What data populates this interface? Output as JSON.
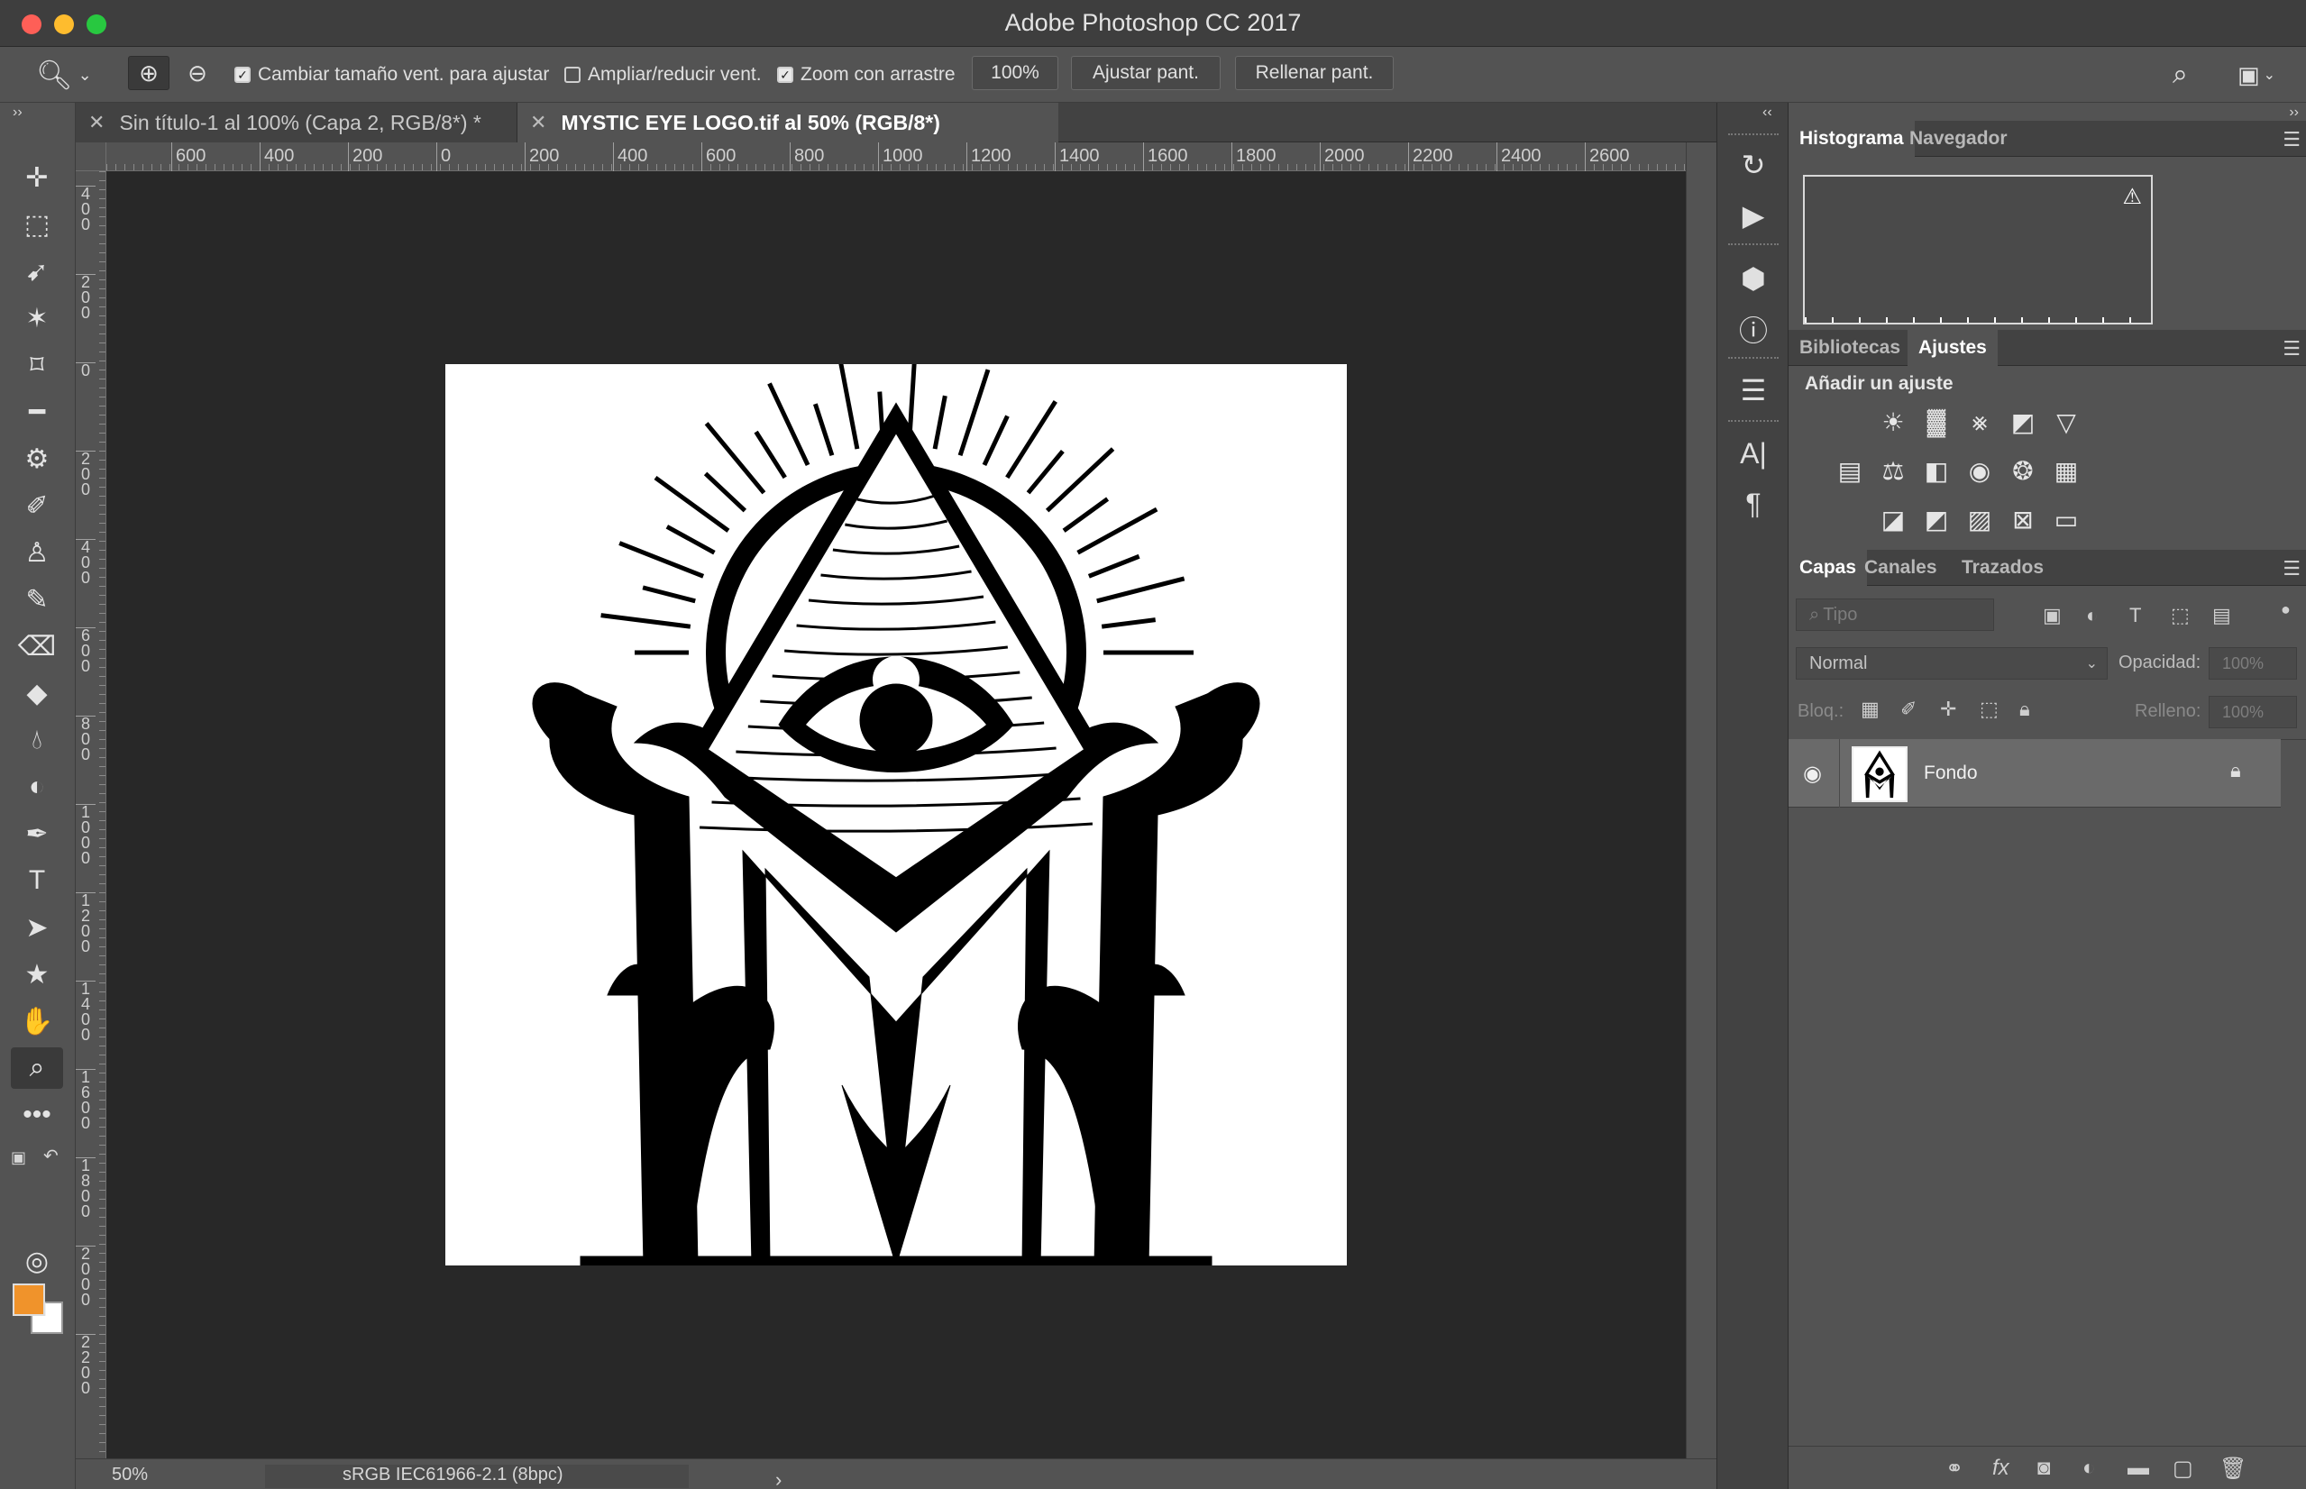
{
  "window": {
    "title": "Adobe Photoshop CC 2017"
  },
  "options_bar": {
    "zoom_in_icon": "zoom-in-icon",
    "zoom_out_icon": "zoom-out-icon",
    "resize_windows_label": "Cambiar tamaño vent. para ajustar",
    "resize_windows_checked": true,
    "zoom_all_windows_label": "Ampliar/reducir vent.",
    "zoom_all_windows_checked": false,
    "scrubby_zoom_label": "Zoom con arrastre",
    "scrubby_zoom_checked": true,
    "btn_100": "100%",
    "btn_fit": "Ajustar pant.",
    "btn_fill": "Rellenar pant."
  },
  "tabs": [
    {
      "label": "Sin título-1 al 100% (Capa 2, RGB/8*) *",
      "active": false
    },
    {
      "label": "MYSTIC EYE LOGO.tif al 50% (RGB/8*)",
      "active": true
    }
  ],
  "ruler_h": [
    "600",
    "400",
    "200",
    "0",
    "200",
    "400",
    "600",
    "800",
    "1000",
    "1200",
    "1400",
    "1600",
    "1800",
    "2000",
    "2200",
    "2400",
    "2600"
  ],
  "ruler_v": [
    "400",
    "200",
    "0",
    "200",
    "400",
    "600",
    "800",
    "1000",
    "1200",
    "1400",
    "1600",
    "1800",
    "2000",
    "2200"
  ],
  "status": {
    "zoom": "50%",
    "profile": "sRGB IEC61966-2.1 (8bpc)",
    "arrow": "›"
  },
  "colors": {
    "foreground": "#f0932b",
    "background": "#ffffff"
  },
  "panels": {
    "histogram_tabs": [
      "Histograma",
      "Navegador"
    ],
    "histogram_warning": "⚠",
    "library_tabs": [
      "Bibliotecas",
      "Ajustes"
    ],
    "adjust_title": "Añadir un ajuste",
    "layers_tabs": [
      "Capas",
      "Canales",
      "Trazados"
    ],
    "filter_placeholder": "Tipo",
    "blend_mode": "Normal",
    "opacity_label": "Opacidad:",
    "opacity_value": "100%",
    "lock_label": "Bloq.:",
    "fill_label": "Relleno:",
    "fill_value": "100%",
    "layers": [
      {
        "name": "Fondo",
        "visible": true,
        "locked": true
      }
    ]
  }
}
